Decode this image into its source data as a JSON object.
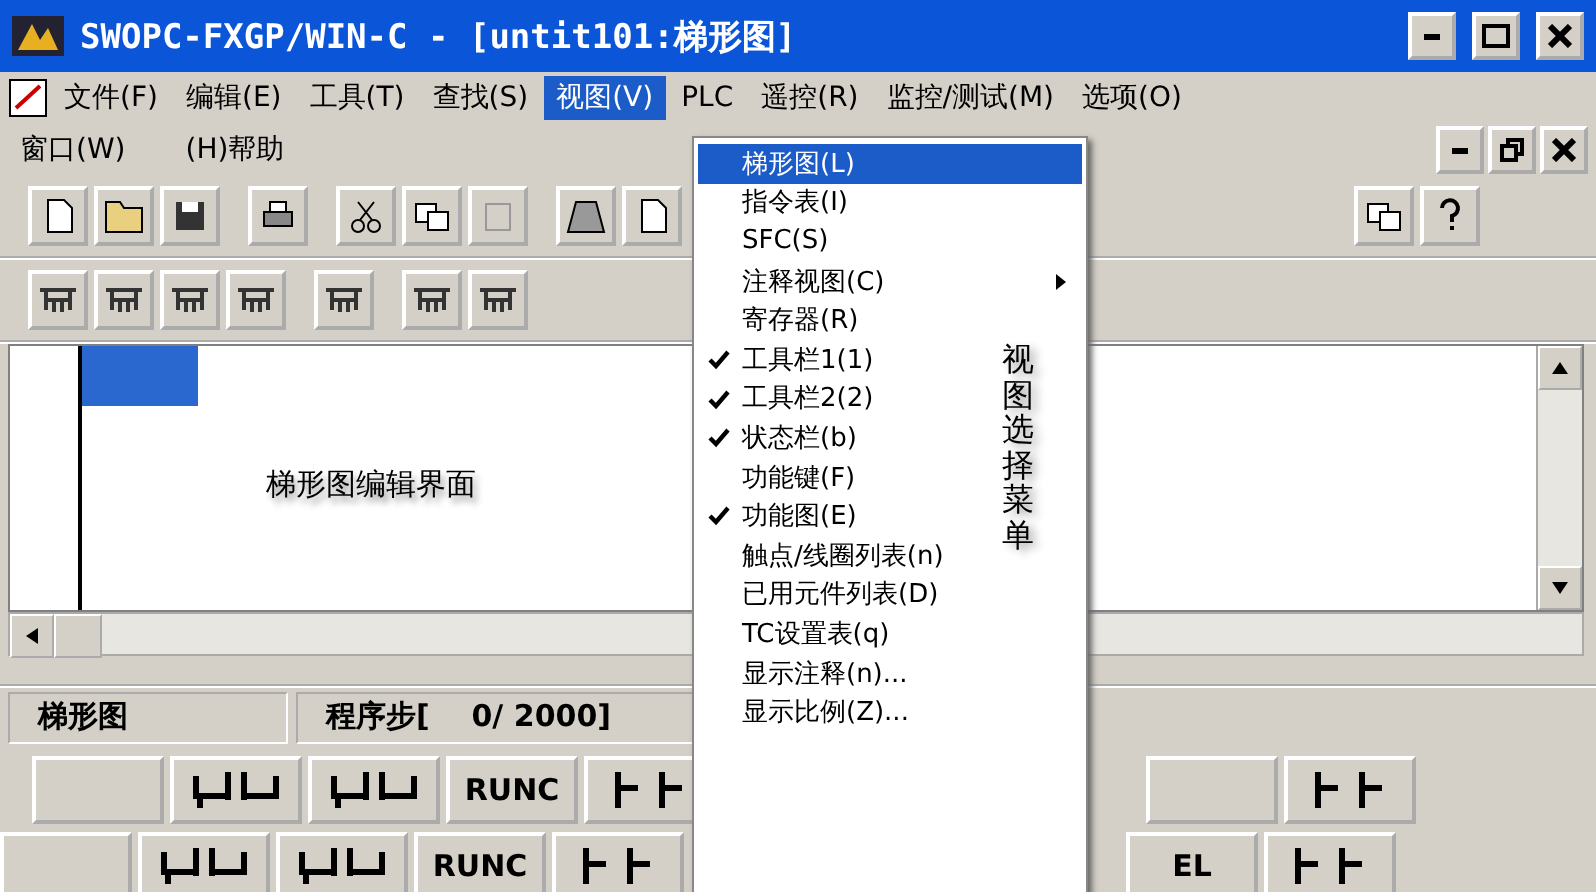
{
  "window": {
    "title": "SWOPC-FXGP/WIN-C - [untit101:梯形图]"
  },
  "menu_bar": [
    {
      "label": "文件(F)",
      "selected": false
    },
    {
      "label": "编辑(E)",
      "selected": false
    },
    {
      "label": "工具(T)",
      "selected": false
    },
    {
      "label": "查找(S)",
      "selected": false
    },
    {
      "label": "视图(V)",
      "selected": true
    },
    {
      "label": "PLC",
      "selected": false
    },
    {
      "label": "遥控(R)",
      "selected": false
    },
    {
      "label": "监控/测试(M)",
      "selected": false
    },
    {
      "label": "选项(O)",
      "selected": false
    },
    {
      "label": "窗口(W)",
      "selected": false
    },
    {
      "label": "(H)帮助",
      "selected": false
    }
  ],
  "view_menu": {
    "items": [
      {
        "label": "梯形图(L)",
        "selected": true,
        "checked": false,
        "submenu": false
      },
      {
        "label": "指令表(I)",
        "selected": false,
        "checked": false,
        "submenu": false
      },
      {
        "label": "SFC(S)",
        "selected": false,
        "checked": false,
        "submenu": false
      },
      {
        "label": "注释视图(C)",
        "selected": false,
        "checked": false,
        "submenu": true
      },
      {
        "label": "寄存器(R)",
        "selected": false,
        "checked": false,
        "submenu": false
      },
      {
        "label": "工具栏1(1)",
        "selected": false,
        "checked": true,
        "submenu": false
      },
      {
        "label": "工具栏2(2)",
        "selected": false,
        "checked": true,
        "submenu": false
      },
      {
        "label": "状态栏(b)",
        "selected": false,
        "checked": true,
        "submenu": false
      },
      {
        "label": "功能键(F)",
        "selected": false,
        "checked": false,
        "submenu": false
      },
      {
        "label": "功能图(E)",
        "selected": false,
        "checked": true,
        "submenu": false
      },
      {
        "label": "触点/线圈列表(n)",
        "selected": false,
        "checked": false,
        "submenu": false
      },
      {
        "label": "已用元件列表(D)",
        "selected": false,
        "checked": false,
        "submenu": false
      },
      {
        "label": "TC设置表(q)",
        "selected": false,
        "checked": false,
        "submenu": false
      },
      {
        "label": "显示注释(n)...",
        "selected": false,
        "checked": false,
        "submenu": false
      },
      {
        "label": "显示比例(Z)...",
        "selected": false,
        "checked": false,
        "submenu": false
      }
    ],
    "annotation": "视图选择菜单"
  },
  "editor": {
    "annotation": "梯形图编辑界面"
  },
  "status_bar": {
    "mode": "梯形图",
    "steps": "程序步[    0/ 2000]"
  },
  "function_keys": [
    [
      {
        "kind": "blank"
      },
      {
        "kind": "contact"
      },
      {
        "kind": "contact"
      },
      {
        "kind": "text",
        "label": "RUNC"
      },
      {
        "kind": "coil"
      },
      {
        "kind": "blank"
      },
      {
        "kind": "coil"
      }
    ],
    [
      {
        "kind": "blank"
      },
      {
        "kind": "contact"
      },
      {
        "kind": "contact"
      },
      {
        "kind": "text",
        "label": "RUNC"
      },
      {
        "kind": "coil"
      },
      {
        "kind": "text",
        "label": "EL"
      },
      {
        "kind": "coil"
      }
    ]
  ]
}
